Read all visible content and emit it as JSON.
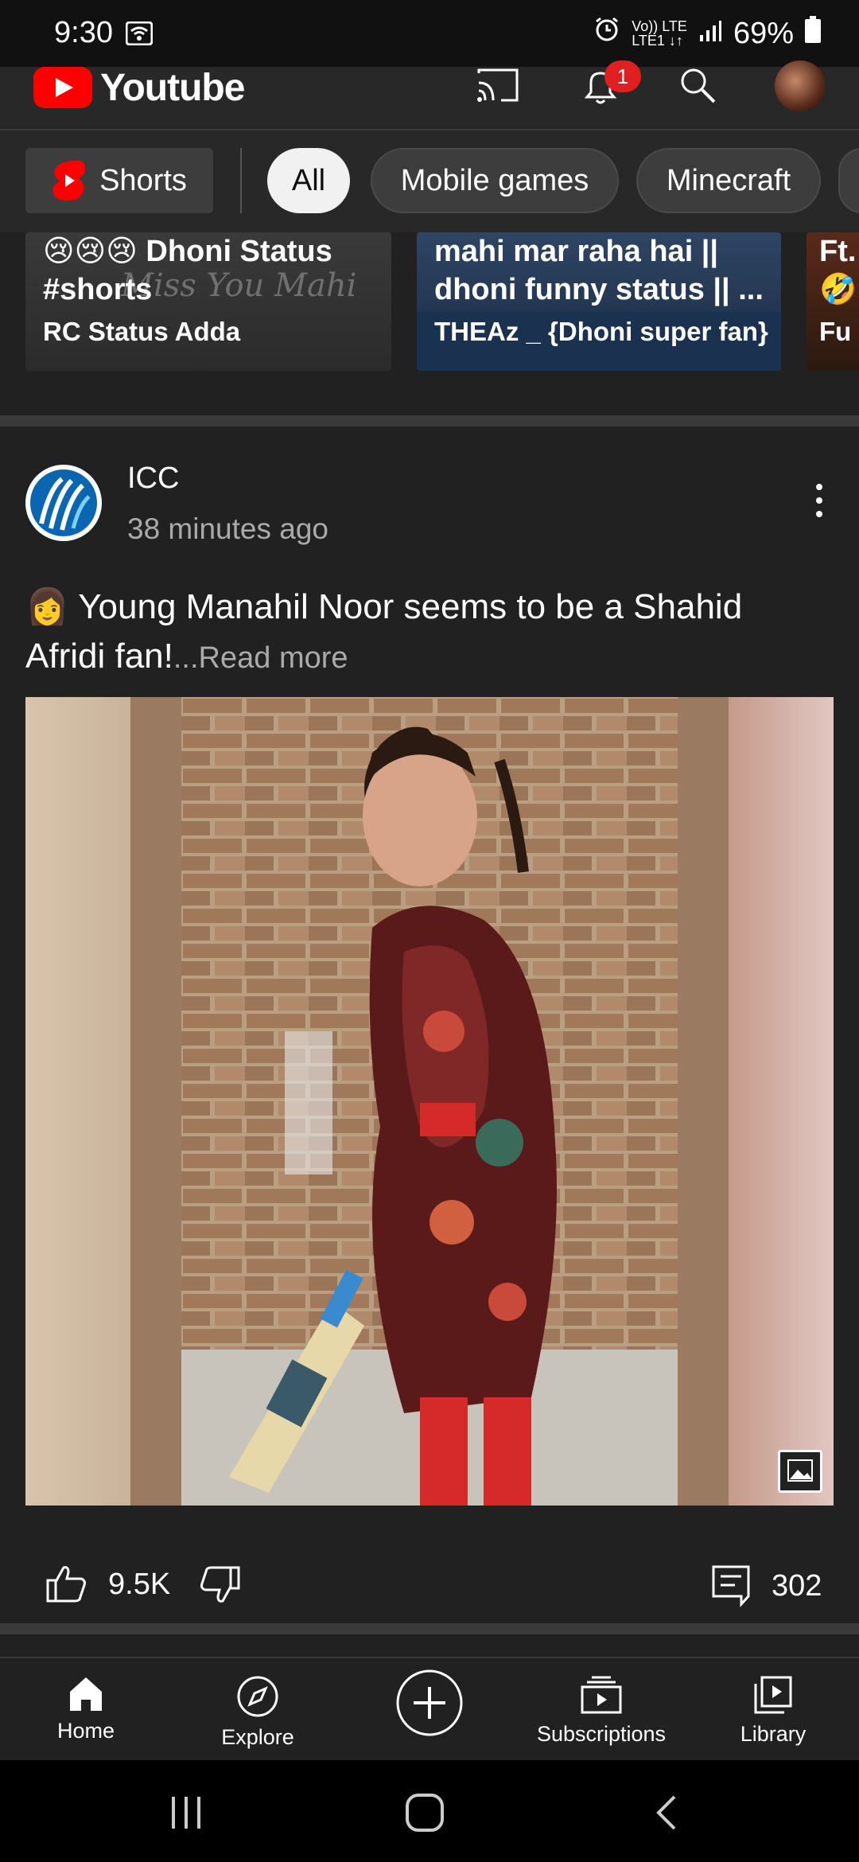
{
  "status_bar": {
    "time": "9:30",
    "network_top": "Vo)) LTE",
    "network_bottom": "LTE1 ↓↑",
    "battery": "69%"
  },
  "app": {
    "brand": "Youtube",
    "notifications_count": "1"
  },
  "chips": [
    {
      "label": "Shorts"
    },
    {
      "label": "All"
    },
    {
      "label": "Mobile games"
    },
    {
      "label": "Minecraft"
    }
  ],
  "shorts": [
    {
      "title_line1": "😢😢😢 Dhoni Status",
      "title_line2": "#shorts",
      "overlay": "Miss You Mahi",
      "channel": "RC Status Adda"
    },
    {
      "title_line1": "mahi mar raha hai ||",
      "title_line2": "dhoni funny status || ...",
      "channel": "THEAz _ {Dhoni super fan}"
    },
    {
      "title_line1": "Ft.",
      "title_line2": "🤣",
      "channel": "Fu"
    }
  ],
  "post": {
    "channel": "ICC",
    "time": "38 minutes ago",
    "text_emoji": "👩",
    "text": "Young Manahil Noor seems to be a Shahid Afridi fan!",
    "read_more": "...Read more",
    "likes": "9.5K",
    "comments": "302"
  },
  "nav": [
    {
      "label": "Home"
    },
    {
      "label": "Explore"
    },
    {
      "label": ""
    },
    {
      "label": "Subscriptions"
    },
    {
      "label": "Library"
    }
  ],
  "colors": {
    "brand_red": "#ff0000",
    "background": "#212121",
    "chip_selected": "#f1f1f1"
  }
}
